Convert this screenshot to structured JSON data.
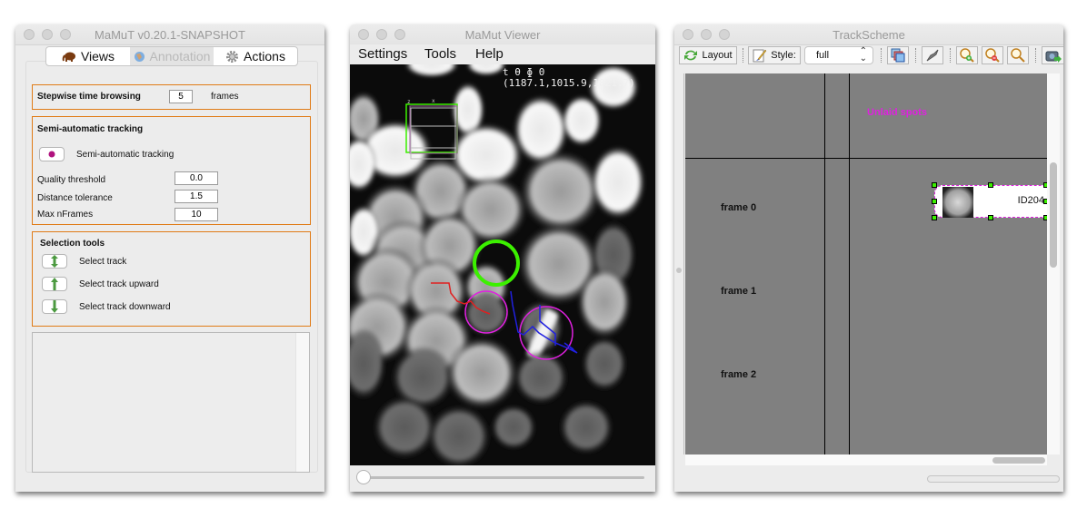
{
  "mamut_window": {
    "title": "MaMuT v0.20.1-SNAPSHOT",
    "tabs": [
      {
        "label": "Views",
        "icon": "elephant-icon",
        "enabled": true
      },
      {
        "label": "Annotation",
        "icon": "globe-icon",
        "enabled": false
      },
      {
        "label": "Actions",
        "icon": "gear-icon",
        "enabled": true
      }
    ],
    "stepwise": {
      "label": "Stepwise time browsing",
      "value": "5",
      "unit": "frames"
    },
    "semi_auto": {
      "heading": "Semi-automatic tracking",
      "button_label": "Semi-automatic tracking",
      "fields": [
        {
          "label": "Quality threshold",
          "value": "0.0"
        },
        {
          "label": "Distance tolerance",
          "value": "1.5"
        },
        {
          "label": "Max nFrames",
          "value": "10"
        }
      ]
    },
    "selection": {
      "heading": "Selection tools",
      "items": [
        {
          "label": "Select track",
          "icon": "up-down-arrow-icon"
        },
        {
          "label": "Select track upward",
          "icon": "up-arrow-icon"
        },
        {
          "label": "Select track downward",
          "icon": "down-arrow-icon"
        }
      ]
    },
    "log_text": ""
  },
  "viewer_window": {
    "title": "MaMut Viewer",
    "menu": [
      "Settings",
      "Tools",
      "Help"
    ],
    "overlay_line1": "t θ ɸ 0",
    "overlay_coords": "(1187.1,1015.9,1821.7)",
    "box_labels": {
      "x": "x",
      "z": "z"
    },
    "timepoint_fraction": 0.0,
    "colors": {
      "selected_spot": "#3cf000",
      "spot": "#e020e0",
      "track_red": "#e02020",
      "track_blue": "#2020e0"
    }
  },
  "trackscheme_window": {
    "title": "TrackScheme",
    "toolbar": {
      "layout_label": "Layout",
      "style_label": "Style:",
      "style_value": "full"
    },
    "unlaid_label": "Unlaid spots",
    "frames": [
      "frame 0",
      "frame 1",
      "frame 2"
    ],
    "spot_label": "ID204",
    "colors": {
      "unlaid": "#e020e0",
      "canvas": "#808080"
    }
  }
}
